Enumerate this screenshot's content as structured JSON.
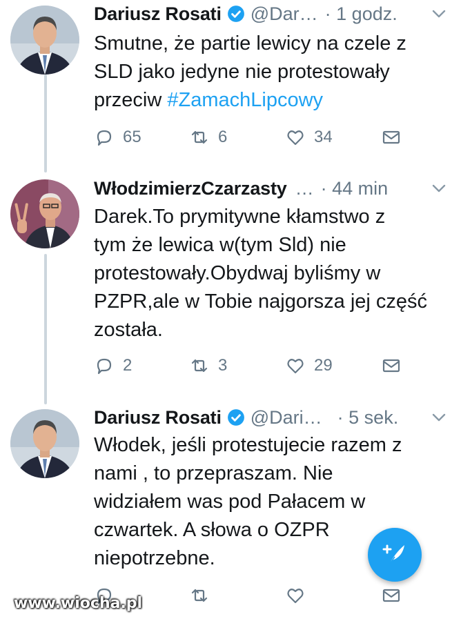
{
  "tweets": [
    {
      "name": "Dariusz Rosati",
      "verified": true,
      "handle": "@Dar…",
      "time": "· 1 godz.",
      "body_lines": [
        "Smutne, że partie lewicy na czele z",
        "SLD jako jedyne nie protestowały"
      ],
      "body_prefix": "przeciw ",
      "hashtag": "#ZamachLipcowy",
      "reply_count": "65",
      "retweet_count": "6",
      "like_count": "34"
    },
    {
      "name": "WłodzimierzCzarzasty",
      "handle": "…",
      "time": "· 44 min",
      "body_lines": [
        "Darek.To prymitywne kłamstwo z",
        "tym że lewica w(tym Sld) nie",
        "protestowały.Obydwaj byliśmy w",
        "PZPR,ale w Tobie najgorsza jej część",
        "została."
      ],
      "reply_count": "2",
      "retweet_count": "3",
      "like_count": "29"
    },
    {
      "name": "Dariusz Rosati",
      "verified": true,
      "handle": "@Dari…",
      "time": "· 5 sek.",
      "body_lines": [
        "Włodek, jeśli protestujecie razem z",
        "nami , to przepraszam. Nie",
        "widziałem was pod Pałacem w",
        "czwartek. A słowa o OZPR",
        "niepotrzebne."
      ]
    }
  ],
  "icons": {
    "reply": "reply-icon",
    "retweet": "retweet-icon",
    "like": "heart-icon",
    "message": "envelope-icon",
    "verified": "verified-badge-icon",
    "chevron": "chevron-down-icon",
    "compose": "compose-tweet-icon"
  },
  "colors": {
    "accent": "#1da1f2",
    "muted": "#657786",
    "text": "#14171a",
    "thread": "#ccd6dd"
  },
  "watermark": "www.wiocha.pl"
}
